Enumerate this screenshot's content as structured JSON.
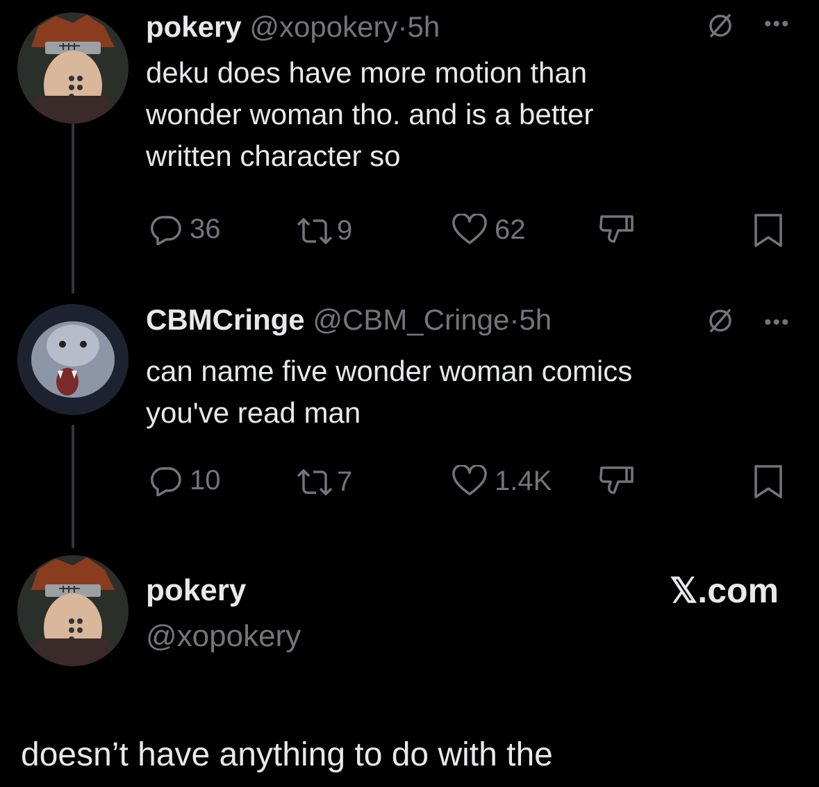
{
  "tweets": [
    {
      "name": "pokery",
      "handle": "@xopokery",
      "sep": "·",
      "time": "5h",
      "lines": [
        "deku does have more motion than",
        "wonder woman tho. and is a better",
        "written character so"
      ],
      "replies": "36",
      "retweets": "9",
      "likes": "62"
    },
    {
      "name": "CBMCringe",
      "handle": "@CBM_Cringe",
      "sep": "·",
      "time": "5h",
      "lines": [
        "can name five wonder woman comics",
        "you've read man"
      ],
      "replies": "10",
      "retweets": "7",
      "likes": "1.4K"
    }
  ],
  "compose": {
    "name": "pokery",
    "handle": "@xopokery",
    "brand": "𝕏.com"
  },
  "draft_text": "doesn’t have anything to do with the",
  "icons": [
    "avatar",
    "block-icon",
    "more-icon",
    "reply-icon",
    "retweet-icon",
    "like-icon",
    "dislike-icon",
    "bookmark-icon"
  ],
  "colors": {
    "background": "#000000",
    "text": "#e7e9ea",
    "muted": "#71767b"
  }
}
